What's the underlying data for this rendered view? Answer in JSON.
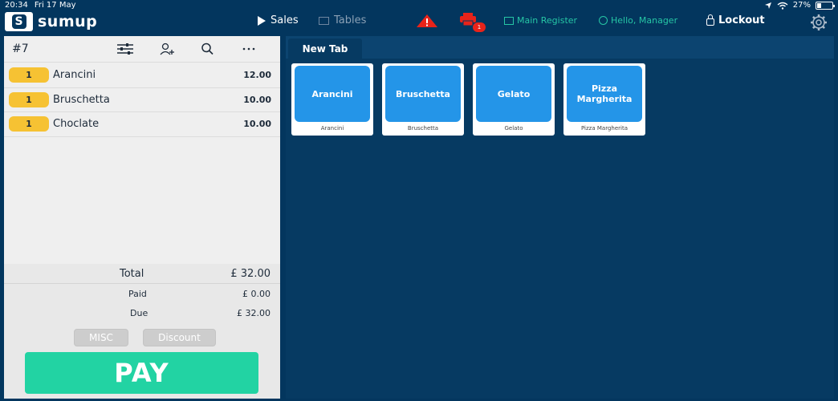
{
  "status_bar": {
    "time": "20:34",
    "date": "Fri 17 May",
    "battery": "27%",
    "battery_level": 0.27
  },
  "brand": {
    "name": "sumup",
    "mark": "S"
  },
  "nav": {
    "sales_label": "Sales",
    "tables_label": "Tables",
    "printer_badge": "1",
    "register_label": "Main Register",
    "greeting": "Hello, Manager",
    "lockout_label": "Lockout"
  },
  "order": {
    "number": "#7",
    "lines": [
      {
        "qty": "1",
        "name": "Arancini",
        "price": "12.00"
      },
      {
        "qty": "1",
        "name": "Bruschetta",
        "price": "10.00"
      },
      {
        "qty": "1",
        "name": "Choclate",
        "price": "10.00"
      }
    ],
    "total_label": "Total",
    "total_value": "£ 32.00",
    "paid_label": "Paid",
    "paid_value": "£ 0.00",
    "due_label": "Due",
    "due_value": "£ 32.00",
    "misc_label": "MISC",
    "discount_label": "Discount",
    "pay_label": "PAY"
  },
  "tabs": [
    {
      "label": "New Tab"
    }
  ],
  "products": [
    {
      "label": "Arancini",
      "caption": "Arancini"
    },
    {
      "label": "Bruschetta",
      "caption": "Bruschetta"
    },
    {
      "label": "Gelato",
      "caption": "Gelato"
    },
    {
      "label": "Pizza Margherita",
      "caption": "Pizza Margherita"
    }
  ],
  "colors": {
    "background": "#03365e",
    "accent_green": "#22d3a3",
    "product_blue": "#2495e8",
    "qty_yellow": "#f6c233",
    "alert_red": "#e8231a",
    "register_teal": "#26c6a5"
  }
}
